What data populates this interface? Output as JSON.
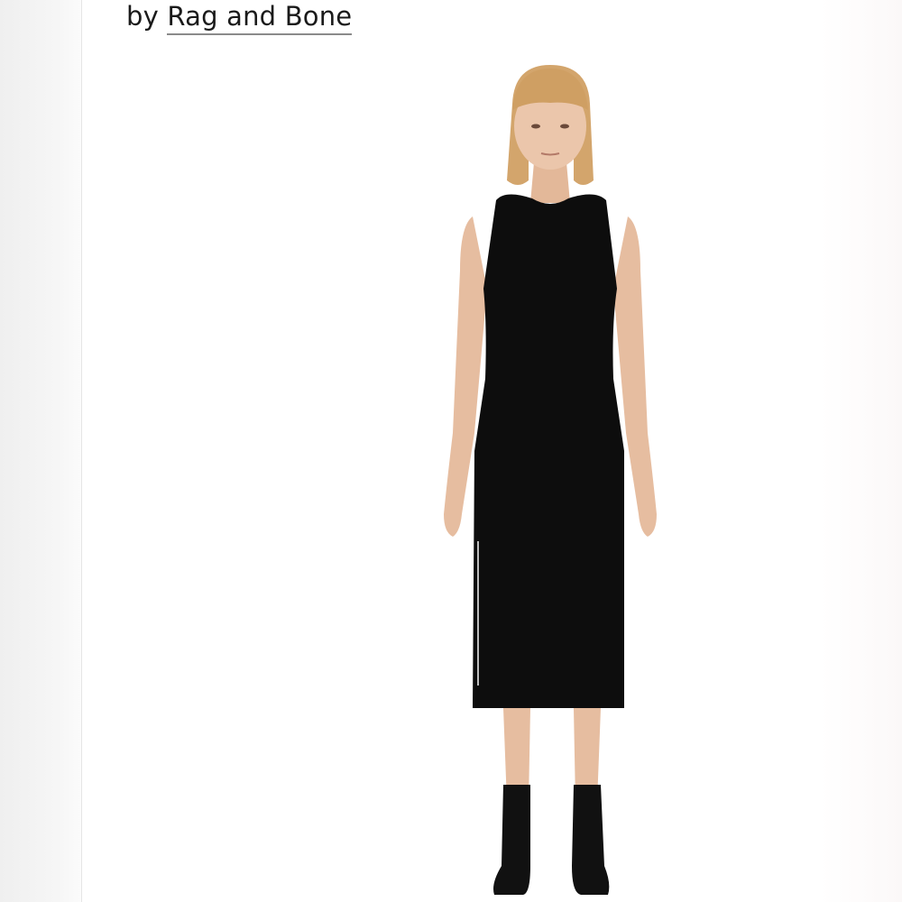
{
  "listing": {
    "by_prefix": "by",
    "brand": "Rag and Bone"
  },
  "product_image": {
    "description_icon": "model-in-black-sleeveless-midi-dress-photo"
  },
  "colors": {
    "dress": "#0d0d0d",
    "skin": "#e8c2a6",
    "hair": "#d3a56c",
    "background": "#ffffff"
  }
}
